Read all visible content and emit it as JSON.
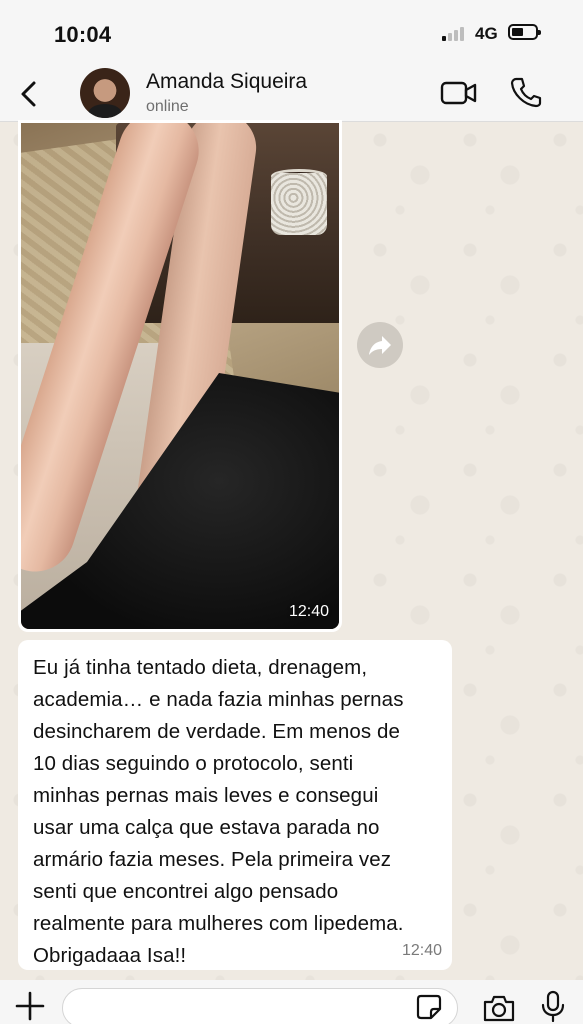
{
  "status_bar": {
    "time": "10:04",
    "network": "4G"
  },
  "header": {
    "contact_name": "Amanda Siqueira",
    "contact_status": "online",
    "icons": [
      "back-chevron-icon",
      "video-call-icon",
      "phone-call-icon"
    ]
  },
  "messages": [
    {
      "type": "image",
      "time": "12:40"
    },
    {
      "type": "text",
      "text": "Eu já tinha tentado dieta, drenagem,\nacademia… e nada fazia minhas pernas\ndesincharem de verdade. Em menos de\n10 dias seguindo o protocolo, senti\nminhas pernas mais leves e consegui\nusar uma calça que estava parada no\narmário fazia meses. Pela primeira vez\nsenti que encontrei algo pensado\nrealmente para mulheres com lipedema.\nObrigadaaa Isa!!",
      "time": "12:40"
    }
  ],
  "input_bar": {
    "placeholder": "",
    "icons": [
      "plus-icon",
      "sticker-icon",
      "camera-icon",
      "microphone-icon"
    ]
  },
  "colors": {
    "chat_background": "#efeae2",
    "bubble": "#ffffff",
    "header_background": "#f6f6f6"
  }
}
